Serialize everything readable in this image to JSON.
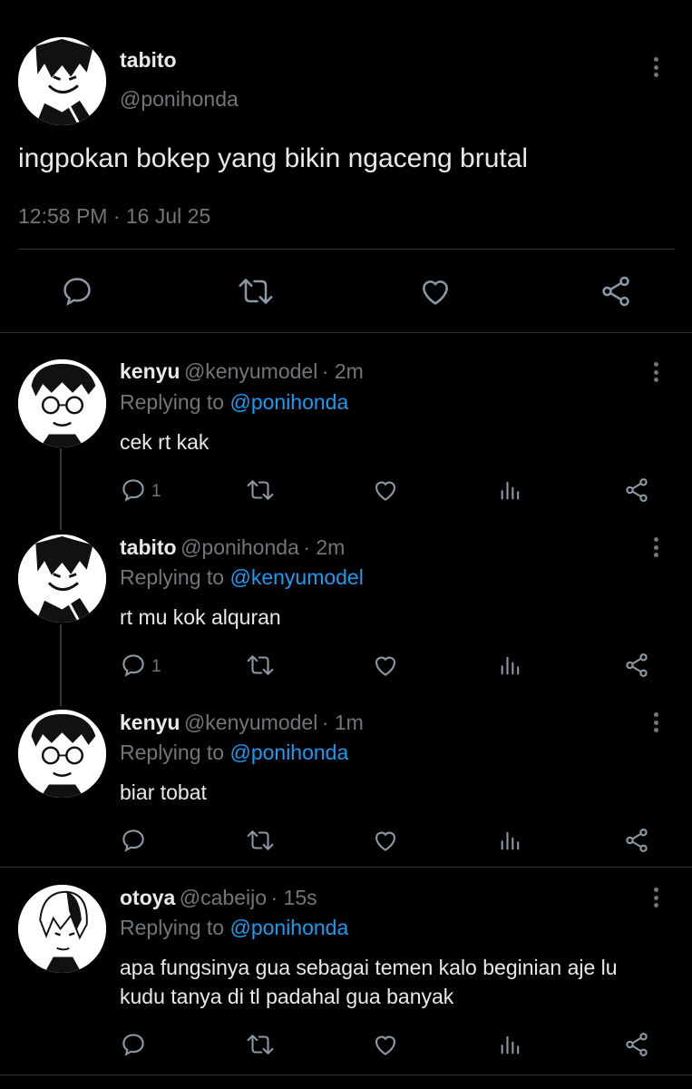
{
  "main_tweet": {
    "name": "tabito",
    "handle": "@ponihonda",
    "text": "ingpokan bokep yang bikin ngaceng brutal",
    "timestamp": "12:58 PM · 16 Jul 25",
    "actions": [
      "reply-icon",
      "retweet-icon",
      "like-icon",
      "share-icon"
    ]
  },
  "replies": [
    {
      "name": "kenyu",
      "handle": "@kenyumodel",
      "time": "· 2m",
      "replying_prefix": "Replying to ",
      "replying_to": "@ponihonda",
      "text": "cek rt kak",
      "reply_count": "1"
    },
    {
      "name": "tabito",
      "handle": "@ponihonda",
      "time": "· 2m",
      "replying_prefix": "Replying to ",
      "replying_to": "@kenyumodel",
      "text": "rt mu kok alquran",
      "reply_count": "1"
    },
    {
      "name": "kenyu",
      "handle": "@kenyumodel",
      "time": "· 1m",
      "replying_prefix": "Replying to ",
      "replying_to": "@ponihonda",
      "text": "biar tobat",
      "reply_count": ""
    },
    {
      "name": "otoya",
      "handle": "@cabeijo",
      "time": "· 15s",
      "replying_prefix": "Replying to ",
      "replying_to": "@ponihonda",
      "text_line1": "apa fungsinya gua sebagai temen kalo beginian aje lu",
      "text_line2": "kudu tanya di tl padahal gua banyak",
      "reply_count": ""
    }
  ],
  "colors": {
    "background": "#000000",
    "text": "#e7e9ea",
    "muted": "#71767b",
    "mention": "#1d9bf0",
    "divider": "#2f3336"
  }
}
